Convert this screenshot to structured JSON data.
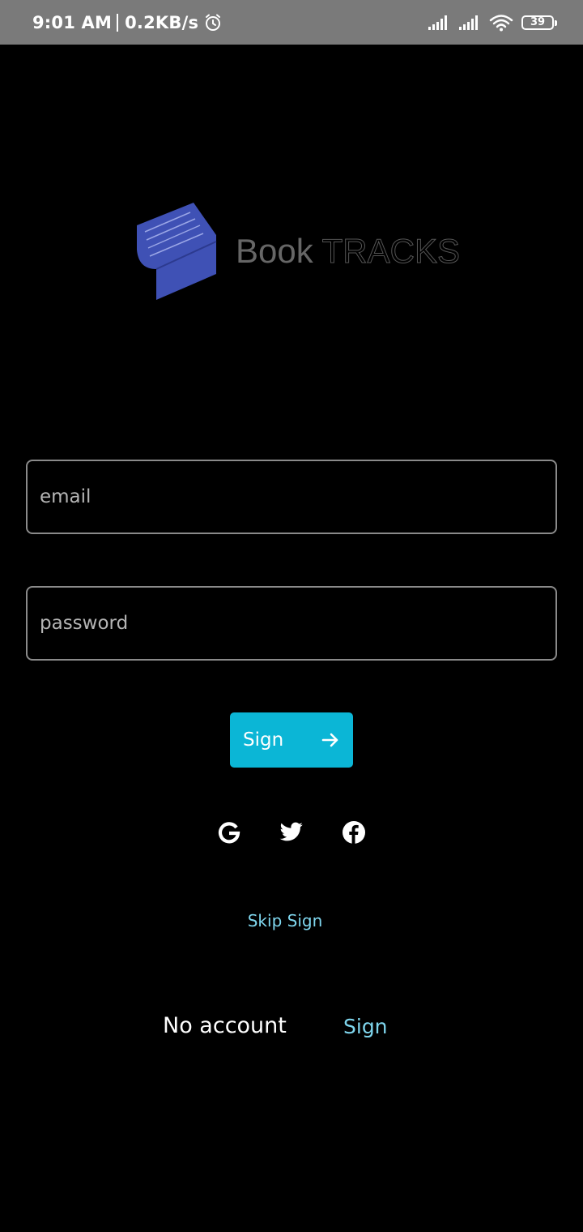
{
  "status_bar": {
    "time": "9:01 AM",
    "network_speed": "0.2KB/s",
    "battery_level": "39",
    "icons": [
      "alarm-icon",
      "signal-icon",
      "signal-icon",
      "wifi-icon",
      "battery-icon"
    ]
  },
  "logo": {
    "word_bold": "Book",
    "word_light": "TRACKS",
    "icon": "book-logo-icon",
    "icon_color": "#3f51b5"
  },
  "form": {
    "email_placeholder": "email",
    "email_value": "",
    "password_placeholder": "password",
    "password_value": "",
    "sign_label": "Sign",
    "sign_icon": "arrow-right-icon",
    "accent_color": "#0bb6d6"
  },
  "social": {
    "items": [
      "google-icon",
      "twitter-icon",
      "facebook-icon"
    ]
  },
  "links": {
    "skip_label": "Skip Sign",
    "no_account_label": "No account",
    "signup_label": "Sign",
    "link_color": "#7fd6ee"
  }
}
